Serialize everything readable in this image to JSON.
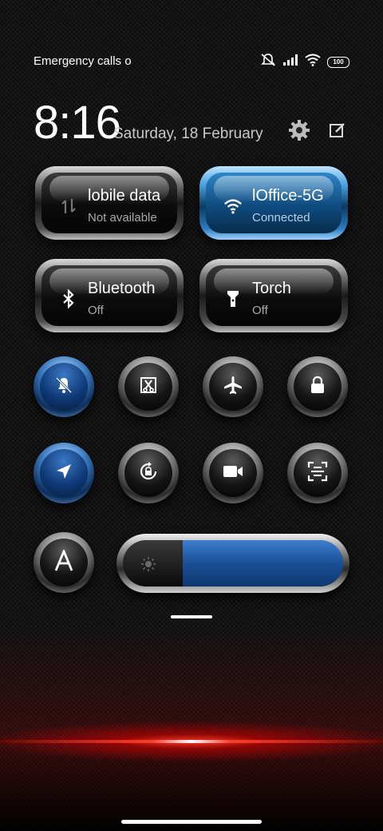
{
  "status_bar": {
    "notification_text": "Emergency calls o",
    "battery": "100"
  },
  "header": {
    "time": "8:16",
    "date": "Saturday, 18 February"
  },
  "tiles": [
    {
      "title": "lobile data",
      "subtitle": "Not available",
      "icon": "mobile-data-icon",
      "active": false
    },
    {
      "title": "lOffice-5G",
      "subtitle": "Connected",
      "icon": "wifi-icon",
      "active": true
    },
    {
      "title": "Bluetooth",
      "subtitle": "Off",
      "icon": "bluetooth-icon",
      "active": false
    },
    {
      "title": "Torch",
      "subtitle": "Off",
      "icon": "torch-icon",
      "active": false
    }
  ],
  "toggles": [
    {
      "icon": "silent-bell-icon",
      "active": true
    },
    {
      "icon": "screenshot-icon",
      "active": false
    },
    {
      "icon": "airplane-icon",
      "active": false
    },
    {
      "icon": "lock-icon",
      "active": false
    },
    {
      "icon": "location-icon",
      "active": true
    },
    {
      "icon": "rotation-lock-icon",
      "active": false
    },
    {
      "icon": "screen-record-icon",
      "active": false
    },
    {
      "icon": "scanner-icon",
      "active": false
    },
    {
      "icon": "auto-brightness-icon",
      "active": false
    }
  ],
  "brightness": {
    "level": 0.73,
    "icon": "brightness-icon"
  },
  "colors": {
    "accent": "#1e5aa6",
    "glow": "#ff3b2f"
  }
}
